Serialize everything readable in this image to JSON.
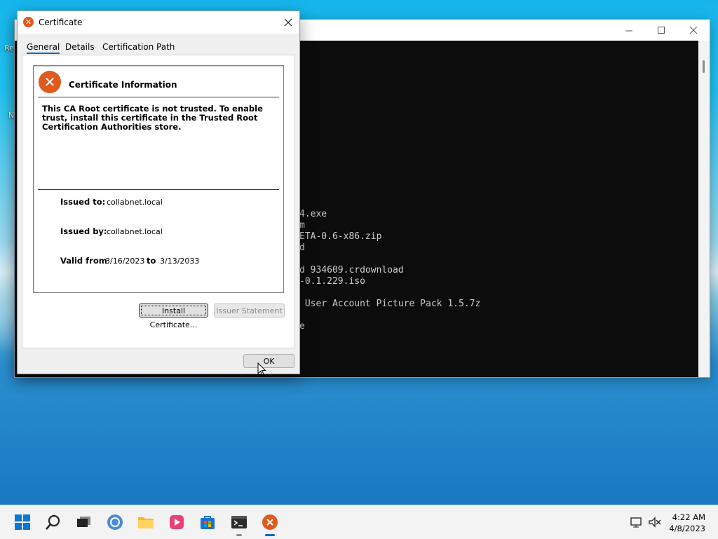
{
  "desktop": {
    "icon_labels": [
      "Re",
      "N"
    ]
  },
  "terminal": {
    "lines": [
      "4.exe",
      "m",
      "ETA-0.6-x86.zip",
      "d",
      "d 934609.crdownload",
      "-0.1.229.iso",
      " User Account Picture Pack 1.5.7z",
      "e"
    ]
  },
  "dialog": {
    "title": "Certificate",
    "tabs": [
      "General",
      "Details",
      "Certification Path"
    ],
    "active_tab": "General",
    "header": "Certificate Information",
    "message": "This CA Root certificate is not trusted. To enable trust, install this certificate in the Trusted Root Certification Authorities store.",
    "issued_to_label": "Issued to:",
    "issued_to": "collabnet.local",
    "issued_by_label": "Issued by:",
    "issued_by": "collabnet.local",
    "valid_from_label": "Valid from",
    "valid_from": "3/16/2023",
    "valid_to_label": "to",
    "valid_to": "3/13/2033",
    "install_button": "Install Certificate...",
    "issuer_button": "Issuer Statement",
    "ok_button": "OK"
  },
  "taskbar": {
    "time": "4:22 AM",
    "date": "4/8/2023"
  },
  "colors": {
    "accent": "#0067c0",
    "error": "#e05a1e"
  }
}
